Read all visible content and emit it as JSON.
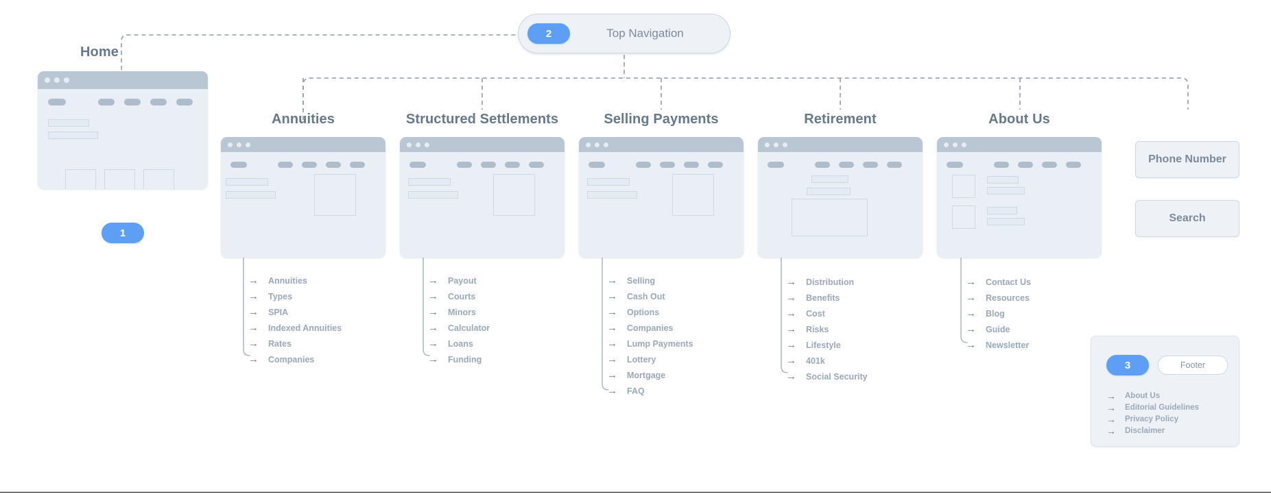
{
  "home": {
    "title": "Home",
    "badge": "1"
  },
  "topnav": {
    "badge": "2",
    "label": "Top Navigation"
  },
  "right_buttons": [
    {
      "label": "Phone Number",
      "name": "phone-number-button"
    },
    {
      "label": "Search",
      "name": "search-button"
    }
  ],
  "columns": [
    {
      "title": "Annuities",
      "links": [
        "Annuities",
        "Types",
        "SPIA",
        "Indexed Annuities",
        "Rates",
        "Companies"
      ]
    },
    {
      "title": "Structured Settlements",
      "links": [
        "Payout",
        "Courts",
        "Minors",
        "Calculator",
        "Loans",
        "Funding"
      ]
    },
    {
      "title": "Selling Payments",
      "links": [
        "Selling",
        "Cash Out",
        "Options",
        "Companies",
        "Lump Payments",
        "Lottery",
        "Mortgage",
        "FAQ"
      ]
    },
    {
      "title": "Retirement",
      "links": [
        "Distribution",
        "Benefits",
        "Cost",
        "Risks",
        "Lifestyle",
        "401k",
        "Social Security"
      ]
    },
    {
      "title": "About Us",
      "links": [
        "Contact Us",
        "Resources",
        "Blog",
        "Guide",
        "Newsletter"
      ]
    }
  ],
  "footer": {
    "badge": "3",
    "label": "Footer",
    "links": [
      "About Us",
      "Editorial Guidelines",
      "Privacy Policy",
      "Disclaimer"
    ]
  },
  "icons": {
    "arrow": "→",
    "arrow_curve": "→"
  },
  "colors": {
    "accent_blue": "#5f9ef5",
    "wireframe_bar": "#b9c6d3",
    "wireframe_body": "#eaeff5",
    "text_gray": "#66788c",
    "link_gray": "#9aa8b8",
    "connector": "#8d9bab"
  }
}
